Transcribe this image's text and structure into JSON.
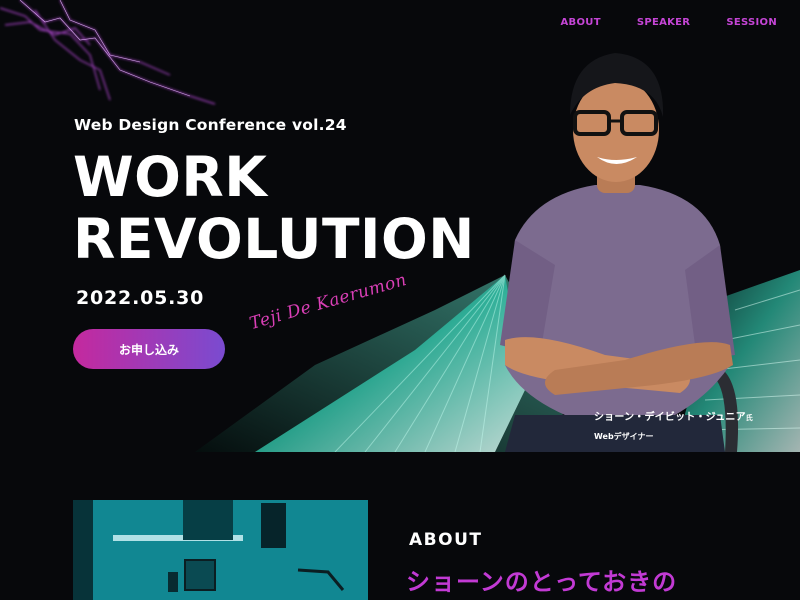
{
  "nav": {
    "items": [
      {
        "label": "ABOUT"
      },
      {
        "label": "SPEAKER"
      },
      {
        "label": "SESSION"
      }
    ]
  },
  "hero": {
    "subtitle": "Web Design Conference vol.24",
    "title_line1": "WORK",
    "title_line2": "REVOLUTION",
    "date": "2022.05.30",
    "signature": "Teji De Kaerumon",
    "cta_label": "お申し込み"
  },
  "speaker": {
    "name": "ショーン・デイビット・ジュニア",
    "suffix": "氏",
    "role": "Webデザイナー"
  },
  "about": {
    "heading": "ABOUT",
    "subheading": "ショーンのとっておきの"
  },
  "colors": {
    "accent": "#c545d6",
    "cta_start": "#c4299e",
    "cta_end": "#7a4bd0",
    "background": "#07080b"
  }
}
